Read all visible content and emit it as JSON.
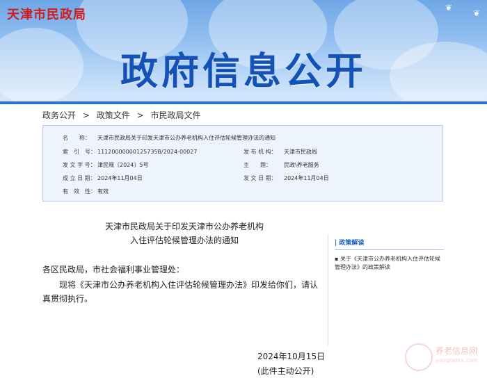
{
  "header": {
    "logo": "天津市民政局",
    "title": "政府信息公开"
  },
  "breadcrumb": [
    {
      "label": "政务公开"
    },
    {
      "sep": ">"
    },
    {
      "label": "政策文件"
    },
    {
      "sep": ">"
    },
    {
      "label": "市民政局文件"
    }
  ],
  "info": {
    "name_label": "名　　称：",
    "name_value": "天津市民政局关于印发天津市公办养老机构入住评估轮候管理办法的通知",
    "index_label": "索　引　号：",
    "index_value": "11120000000125735B/2024-00027",
    "org_label": "发 布 机 构：",
    "org_value": "天津市民政局",
    "docno_label": "发 文 字 号：",
    "docno_value": "津民规〔2024〕5号",
    "topic_label": "主　　题：",
    "topic_value": "民政\\养老服务",
    "created_label": "成 立 日 期：",
    "created_value": "2024年11月04日",
    "publish_label": "发 文 日 期：",
    "publish_value": "2024年11月04日",
    "valid_label": "有　效　性：",
    "valid_value": "有效"
  },
  "document": {
    "title_line1": "天津市民政局关于印发天津市公办养老机构",
    "title_line2": "入住评估轮候管理办法的通知",
    "salutation": "各区民政局，市社会福利事业管理处：",
    "para1_line1": "现将《天津市公办养老机构入住评估轮候管理办法》印发给你们，请认",
    "para1_line2": "真贯彻执行。",
    "date": "2024年10月15日",
    "note": "(此件主动公开)"
  },
  "sidebar": {
    "heading": "| 政策解读",
    "item_line1": "▪ 关于《天津市公办养老机构入住评估轮候",
    "item_line2": "管理办法》的政策解读"
  },
  "watermark": {
    "text": "养老信息网",
    "url": "yanglaoxx.com"
  },
  "colors": {
    "logo": "#d11b1b",
    "title": "#1452b8",
    "link": "#1f5fc0",
    "info_bg": "#eef4fd"
  }
}
